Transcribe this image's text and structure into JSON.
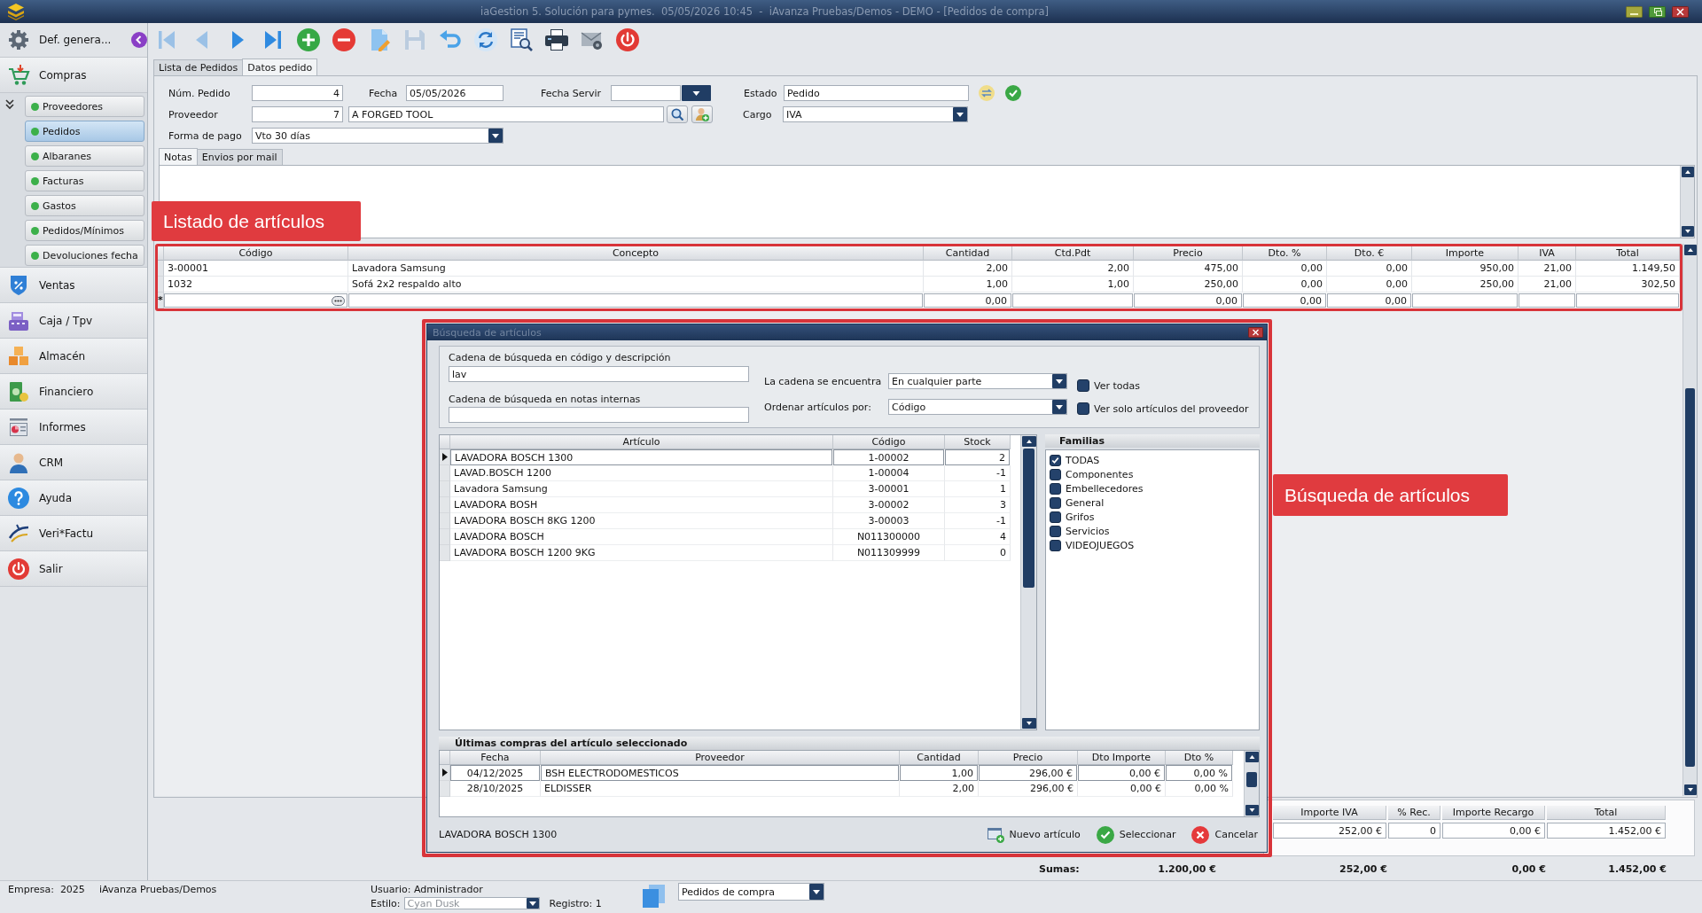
{
  "window": {
    "title": "iaGestion 5. Solución para pymes.  05/05/2026 10:45  -  iAvanza Pruebas/Demos - DEMO - [Pedidos de compra]"
  },
  "sidebar": {
    "header": {
      "label": "Def. genera..."
    },
    "modules": [
      {
        "label": "Compras",
        "items": [
          {
            "label": "Proveedores",
            "selected": false
          },
          {
            "label": "Pedidos",
            "selected": true
          },
          {
            "label": "Albaranes",
            "selected": false
          },
          {
            "label": "Facturas",
            "selected": false
          },
          {
            "label": "Gastos",
            "selected": false
          },
          {
            "label": "Pedidos/Mínimos",
            "selected": false
          },
          {
            "label": "Devoluciones fecha",
            "selected": false
          }
        ]
      },
      {
        "label": "Ventas"
      },
      {
        "label": "Caja / Tpv"
      },
      {
        "label": "Almacén"
      },
      {
        "label": "Financiero"
      },
      {
        "label": "Informes"
      },
      {
        "label": "CRM"
      },
      {
        "label": "Ayuda"
      },
      {
        "label": "Veri*Factu"
      },
      {
        "label": "Salir"
      }
    ]
  },
  "toolbar": [
    {
      "kind": "first",
      "disabled": true
    },
    {
      "kind": "previous",
      "disabled": true
    },
    {
      "kind": "next",
      "disabled": false
    },
    {
      "kind": "last",
      "disabled": false
    },
    {
      "kind": "add",
      "disabled": false
    },
    {
      "kind": "delete",
      "disabled": false
    },
    {
      "kind": "edit",
      "disabled": false
    },
    {
      "kind": "save",
      "disabled": true
    },
    {
      "kind": "undo",
      "disabled": false
    },
    {
      "kind": "refresh",
      "disabled": false
    },
    {
      "kind": "find",
      "disabled": false
    },
    {
      "kind": "print",
      "disabled": false
    },
    {
      "kind": "mail",
      "disabled": false
    },
    {
      "kind": "exit",
      "disabled": false
    }
  ],
  "tabs": [
    {
      "label": "Lista de Pedidos",
      "selected": false
    },
    {
      "label": "Datos pedido",
      "selected": true
    }
  ],
  "form": {
    "order_number": {
      "label": "Núm. Pedido",
      "value": "4"
    },
    "date": {
      "label": "Fecha",
      "value": "05/05/2026"
    },
    "delivery_date": {
      "label": "Fecha Servir"
    },
    "status": {
      "label": "Estado",
      "value": "Pedido"
    },
    "supplier": {
      "label": "Proveedor",
      "code": "7",
      "name": "A FORGED TOOL"
    },
    "charge": {
      "label": "Cargo",
      "value": "IVA"
    },
    "payment": {
      "label": "Forma de pago",
      "value": "Vto 30 días"
    }
  },
  "subtabs": [
    {
      "label": "Notas",
      "selected": true
    },
    {
      "label": "Envios por mail",
      "selected": false
    }
  ],
  "lines": {
    "highlighted": true,
    "columns": [
      "Código",
      "Concepto",
      "Cantidad",
      "Ctd.Pdt",
      "Precio",
      "Dto. %",
      "Dto. €",
      "Importe",
      "IVA",
      "Total"
    ],
    "rows": [
      [
        "3-00001",
        "Lavadora Samsung",
        "2,00",
        "2,00",
        "475,00",
        "0,00",
        "0,00",
        "950,00",
        "21,00",
        "1.149,50"
      ],
      [
        "1032",
        "Sofá 2x2 respaldo alto",
        "1,00",
        "1,00",
        "250,00",
        "0,00",
        "0,00",
        "250,00",
        "21,00",
        "302,50"
      ]
    ],
    "new_row": {
      "marker": "*",
      "quantity": "0,00",
      "price": "0,00",
      "discount_pct": "0,00",
      "discount_eur": "0,00"
    }
  },
  "totals": {
    "columns": [
      "Importe IVA",
      "% Rec.",
      "Importe Recargo",
      "Total"
    ],
    "values": [
      "252,00 €",
      "0",
      "0,00 €",
      "1.452,00 €"
    ]
  },
  "sums": {
    "label": "Sumas:",
    "values": [
      "1.200,00 €",
      "252,00 €",
      "0,00 €",
      "1.452,00 €"
    ]
  },
  "dialog": {
    "title": "Búsqueda de artículos",
    "highlighted": true,
    "search_code": {
      "label": "Cadena de búsqueda en código y descripción",
      "value": "lav"
    },
    "search_notes": {
      "label": "Cadena de búsqueda en notas internas"
    },
    "match": {
      "label": "La cadena se encuentra",
      "value": "En cualquier parte"
    },
    "sort": {
      "label": "Ordenar artículos por:",
      "value": "Código"
    },
    "options": [
      {
        "label": "Ver todas",
        "checked": false
      },
      {
        "label": "Ver solo artículos del proveedor",
        "checked": false
      }
    ],
    "articles": {
      "columns": [
        "Artículo",
        "Código",
        "Stock"
      ],
      "rows": [
        {
          "cells": [
            "LAVADORA BOSCH 1300",
            "1-00002",
            "2"
          ],
          "selected": true
        },
        {
          "cells": [
            "LAVAD.BOSCH 1200",
            "1-00004",
            "-1"
          ],
          "selected": false
        },
        {
          "cells": [
            "Lavadora Samsung",
            "3-00001",
            "1"
          ],
          "selected": false
        },
        {
          "cells": [
            "LAVADORA BOSH",
            "3-00002",
            "3"
          ],
          "selected": false
        },
        {
          "cells": [
            "LAVADORA BOSCH 8KG 1200",
            "3-00003",
            "-1"
          ],
          "selected": false
        },
        {
          "cells": [
            "LAVADORA BOSCH",
            "N011300000",
            "4"
          ],
          "selected": false
        },
        {
          "cells": [
            "LAVADORA BOSCH 1200 9KG",
            "N011309999",
            "0"
          ],
          "selected": false
        }
      ]
    },
    "families": {
      "title": "Familias",
      "items": [
        {
          "label": "TODAS",
          "checked": true
        },
        {
          "label": "Componentes",
          "checked": false
        },
        {
          "label": "Embellecedores",
          "checked": false
        },
        {
          "label": "General",
          "checked": false
        },
        {
          "label": "Grifos",
          "checked": false
        },
        {
          "label": "Servicios",
          "checked": false
        },
        {
          "label": "VIDEOJUEGOS",
          "checked": false
        }
      ]
    },
    "purchases": {
      "title": "Últimas compras del artículo seleccionado",
      "columns": [
        "Fecha",
        "Proveedor",
        "Cantidad",
        "Precio",
        "Dto Importe",
        "Dto %"
      ],
      "rows": [
        {
          "cells": [
            "04/12/2025",
            "BSH ELECTRODOMESTICOS",
            "1,00",
            "296,00 €",
            "0,00 €",
            "0,00 %"
          ],
          "selected": true
        },
        {
          "cells": [
            "28/10/2025",
            "ELDISSER",
            "2,00",
            "296,00 €",
            "0,00 €",
            "0,00 %"
          ],
          "selected": false
        }
      ]
    },
    "current_article": "LAVADORA BOSCH 1300",
    "buttons": [
      {
        "kind": "new",
        "label": "Nuevo artículo"
      },
      {
        "kind": "select",
        "label": "Seleccionar"
      },
      {
        "kind": "cancel",
        "label": "Cancelar"
      }
    ]
  },
  "callouts": [
    {
      "label": "Listado de artículos"
    },
    {
      "label": "Búsqueda de artículos"
    }
  ],
  "status_bar": {
    "company_label": "Empresa:",
    "company_year": "2025",
    "company_name": "iAvanza Pruebas/Demos",
    "user": "Usuario: Administrador",
    "style_label": "Estilo:",
    "style_value": "Cyan Dusk",
    "records": "Registro: 1",
    "module": "Pedidos de compra"
  }
}
